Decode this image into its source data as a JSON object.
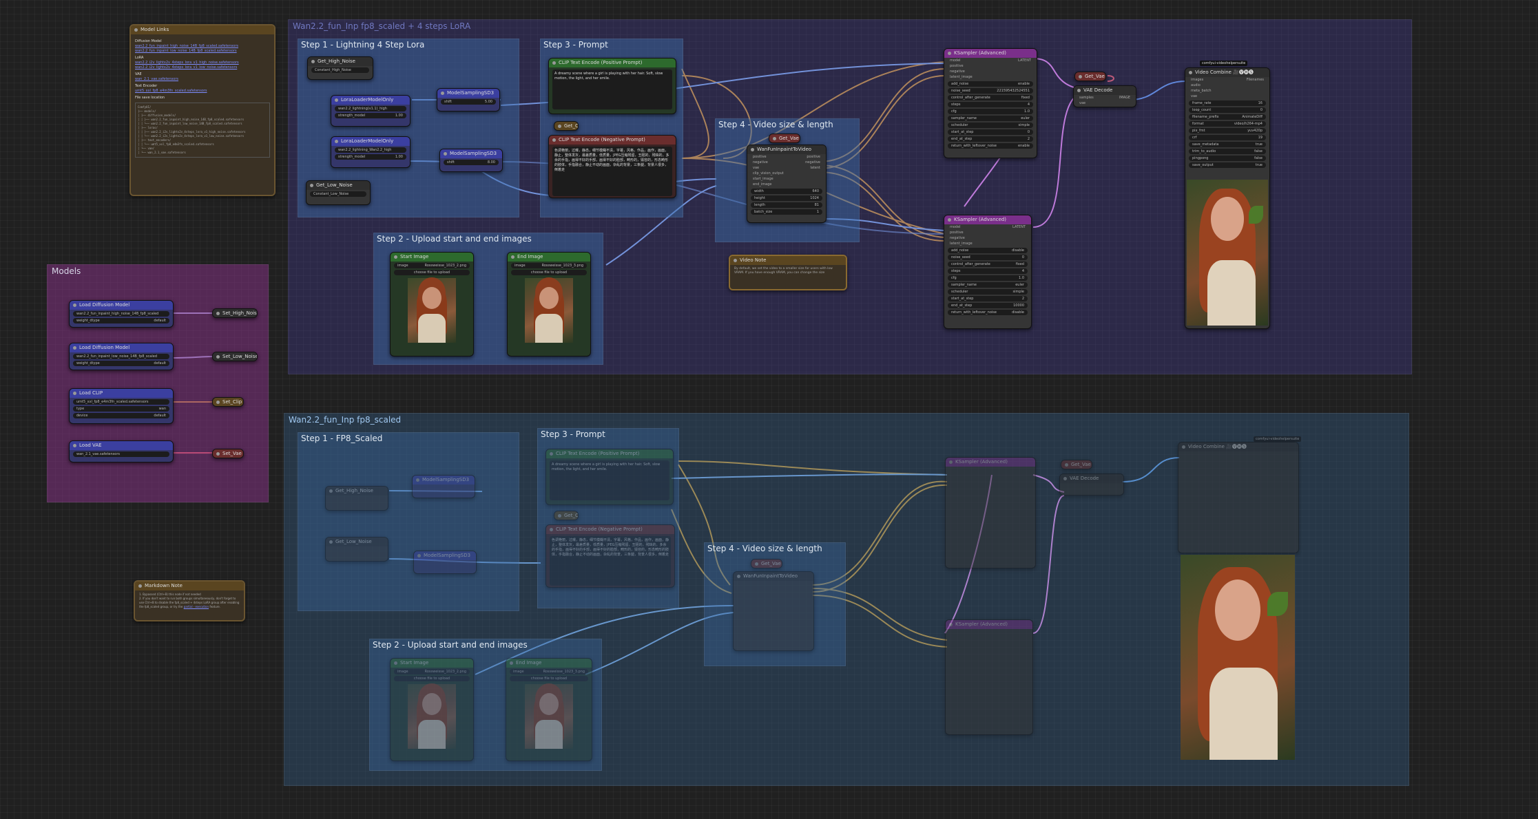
{
  "top_group": {
    "title": "Wan2.2_fun_Inp fp8_scaled + 4 steps LoRA",
    "step1_title": "Step 1 - Lightning 4 Step Lora",
    "step2_title": "Step 2 - Upload start and end images",
    "step3_title": "Step 3 - Prompt",
    "step4_title": "Step 4 - Video size & length",
    "get_high_noise": "Get_High_Noise",
    "get_high_noise_widget": "Constant_High_Noise",
    "get_low_noise": "Get_Low_Noise",
    "get_low_noise_widget": "Constant_Low_Noise",
    "lora_loader1": "LoraLoaderModelOnly",
    "lora_name1": "wan2.2_lightning(v1.1)_high",
    "lora_strength1": "1.00",
    "lora_loader2": "LoraLoaderModelOnly",
    "lora_name2": "wan2.2_lightning_Wan2.2_high",
    "lora_strength2": "1.00",
    "sampling1": "ModelSamplingSD3",
    "sampling1_shift": "5.00",
    "sampling2": "ModelSamplingSD3",
    "sampling2_shift": "8.00",
    "pos_prompt_title": "CLIP Text Encode (Positive Prompt)",
    "pos_prompt_text": "A dreamy scene where a girl is playing with her hair. Soft, slow motion, the light, and her smile.",
    "neg_prompt_title": "CLIP Text Encode (Negative Prompt)",
    "neg_prompt_text": "色调艳丽，过曝，静态，细节模糊不清，字幕，风格，作品，画作，画面，静止，整体发灰，最差质量，低质量，JPEG压缩残留，丑陋的，残缺的，多余的手指，画得不好的手部，画得不好的脸部，畸形的，毁容的，形态畸形的肢体，手指融合，静止不动的画面，杂乱的背景，三条腿，背景人很多，倒着走",
    "get_clip": "Get_Clip",
    "start_image": "Start Image",
    "start_image_file": "Rossweisse_1023_2.png",
    "end_image": "End Image",
    "end_image_file": "Rossweisse_1023_3.png",
    "upload_label": "choose file to upload",
    "wan_fun_node": "WanFunInpaintToVideo",
    "width_label": "width",
    "width_val": "640",
    "height_label": "height",
    "height_val": "1024",
    "length_label": "length",
    "length_val": "81",
    "batch_label": "batch_size",
    "batch_val": "1",
    "video_note_title": "Video Note",
    "video_note_text": "By default, we set the video to a smaller size for users with low VRAM. If you have enough VRAM, you can change the size",
    "sampler1": "KSampler (Advanced)",
    "sampler2": "KSampler (Advanced)",
    "get_vae": "Get_Vae",
    "vae_decode": "VAE Decode",
    "video_combine": "Video Combine 🎥🅥🅗🅢",
    "vc_badge": "comfyui-videohelpersuite",
    "frame_rate": "16",
    "filename_prefix": "AnimateDiff",
    "format": "video/h264-mp4",
    "pix_fmt": "yuv420p",
    "crf": "19"
  },
  "bottom_group": {
    "title": "Wan2.2_fun_Inp fp8_scaled",
    "step1_title": "Step 1 - FP8_Scaled",
    "step2_title": "Step 2 - Upload start and end images",
    "step3_title": "Step 3 - Prompt",
    "step4_title": "Step 4 - Video size & length",
    "get_high_noise": "Get_High_Noise",
    "get_low_noise": "Get_Low_Noise",
    "sampling1": "ModelSamplingSD3",
    "sampling2": "ModelSamplingSD3",
    "pos_prompt_title": "CLIP Text Encode (Positive Prompt)",
    "pos_prompt_text": "A dreamy scene where a girl is playing with her hair. Soft, slow motion, the light, and her smile.",
    "neg_prompt_title": "CLIP Text Encode (Negative Prompt)",
    "neg_prompt_text": "色调艳丽，过曝，静态，细节模糊不清，字幕，风格，作品，画作，画面，静止，整体发灰，最差质量，低质量，JPEG压缩残留，丑陋的，残缺的，多余的手指，画得不好的手部，画得不好的脸部，畸形的，毁容的，形态畸形的肢体，手指融合，静止不动的画面，杂乱的背景，三条腿，背景人很多，倒着走",
    "get_clip": "Get_Clip",
    "start_image": "Start Image",
    "start_image_file": "Rossweisse_1023_2.png",
    "end_image": "End Image",
    "end_image_file": "Rossweisse_1023_3.png",
    "upload_label": "choose file to upload",
    "wan_fun_node": "WanFunInpaintToVideo",
    "sampler1": "KSampler (Advanced)",
    "sampler2": "KSampler (Advanced)",
    "get_vae": "Get_Vae",
    "vae_decode": "VAE Decode",
    "video_combine": "Video Combine 🎥🅥🅗🅢",
    "vc_badge": "comfyui-videohelpersuite"
  },
  "models": {
    "title": "Models",
    "load_diffusion1": "Load Diffusion Model",
    "unet1": "wan2.2_fun_inpaint_high_noise_14B_fp8_scaled",
    "dtype1": "default",
    "set_high": "Set_High_Noise",
    "load_diffusion2": "Load Diffusion Model",
    "unet2": "wan2.2_fun_inpaint_low_noise_14B_fp8_scaled",
    "dtype2": "default",
    "set_low": "Set_Low_Noise",
    "load_clip": "Load CLIP",
    "clip_name": "umt5_xxl_fp8_e4m3fn_scaled.safetensors",
    "clip_type": "wan",
    "clip_device": "default",
    "set_clip": "Set_Clip",
    "load_vae": "Load VAE",
    "vae_name": "wan_2.1_vae.safetensors",
    "set_vae": "Set_Vae"
  },
  "model_links": {
    "title": "Model Links",
    "heading_diffusion": "Diffusion Model",
    "link1": "wan2.2_fun_inpaint_high_noise_14B_fp8_scaled.safetensors",
    "link2": "wan2.2_fun_inpaint_low_noise_14B_fp8_scaled.safetensors",
    "heading_lora": "LoRA",
    "link3": "wan2.2_i2v_lightx2v_4steps_lora_v1_high_noise.safetensors",
    "link4": "wan2.2_i2v_lightx2v_4steps_lora_v1_low_noise.safetensors",
    "heading_vae": "VAE",
    "link5": "wan_2.1_vae.safetensors",
    "heading_text": "Text Encoder",
    "link6": "umt5_xxl_fp8_e4m3fn_scaled.safetensors",
    "heading_loc": "File save location",
    "tree": [
      "ComfyUI/",
      "├── models/",
      "│   ├── diffusion_models/",
      "│   │   ├── wan2.2_fun_inpaint_high_noise_14B_fp8_scaled.safetensors",
      "│   │   └── wan2.2_fun_inpaint_low_noise_14B_fp8_scaled.safetensors",
      "│   ├── loras/",
      "│   │   ├── wan2.2_i2v_lightx2v_4steps_lora_v1_high_noise.safetensors",
      "│   │   └── wan2.2_i2v_lightx2v_4steps_lora_v1_low_noise.safetensors",
      "│   ├── text_encoders/",
      "│   │   └── umt5_xxl_fp8_e4m3fn_scaled.safetensors",
      "│   └── vae/",
      "│       └── wan_2.1_vae.safetensors"
    ]
  },
  "markdown_note": {
    "title": "Markdown Note",
    "line1": "1. Bypassed (Ctrl+B) this node if not needed",
    "line2": "2. If you don't want to run both groups simultaneously, don't forget to use Ctrl+B to disable the fp8_scaled + 4steps LoRA group after enabling the fp8_scaled group, or try the",
    "link_text": "partial - execution",
    "line3": "feature."
  }
}
